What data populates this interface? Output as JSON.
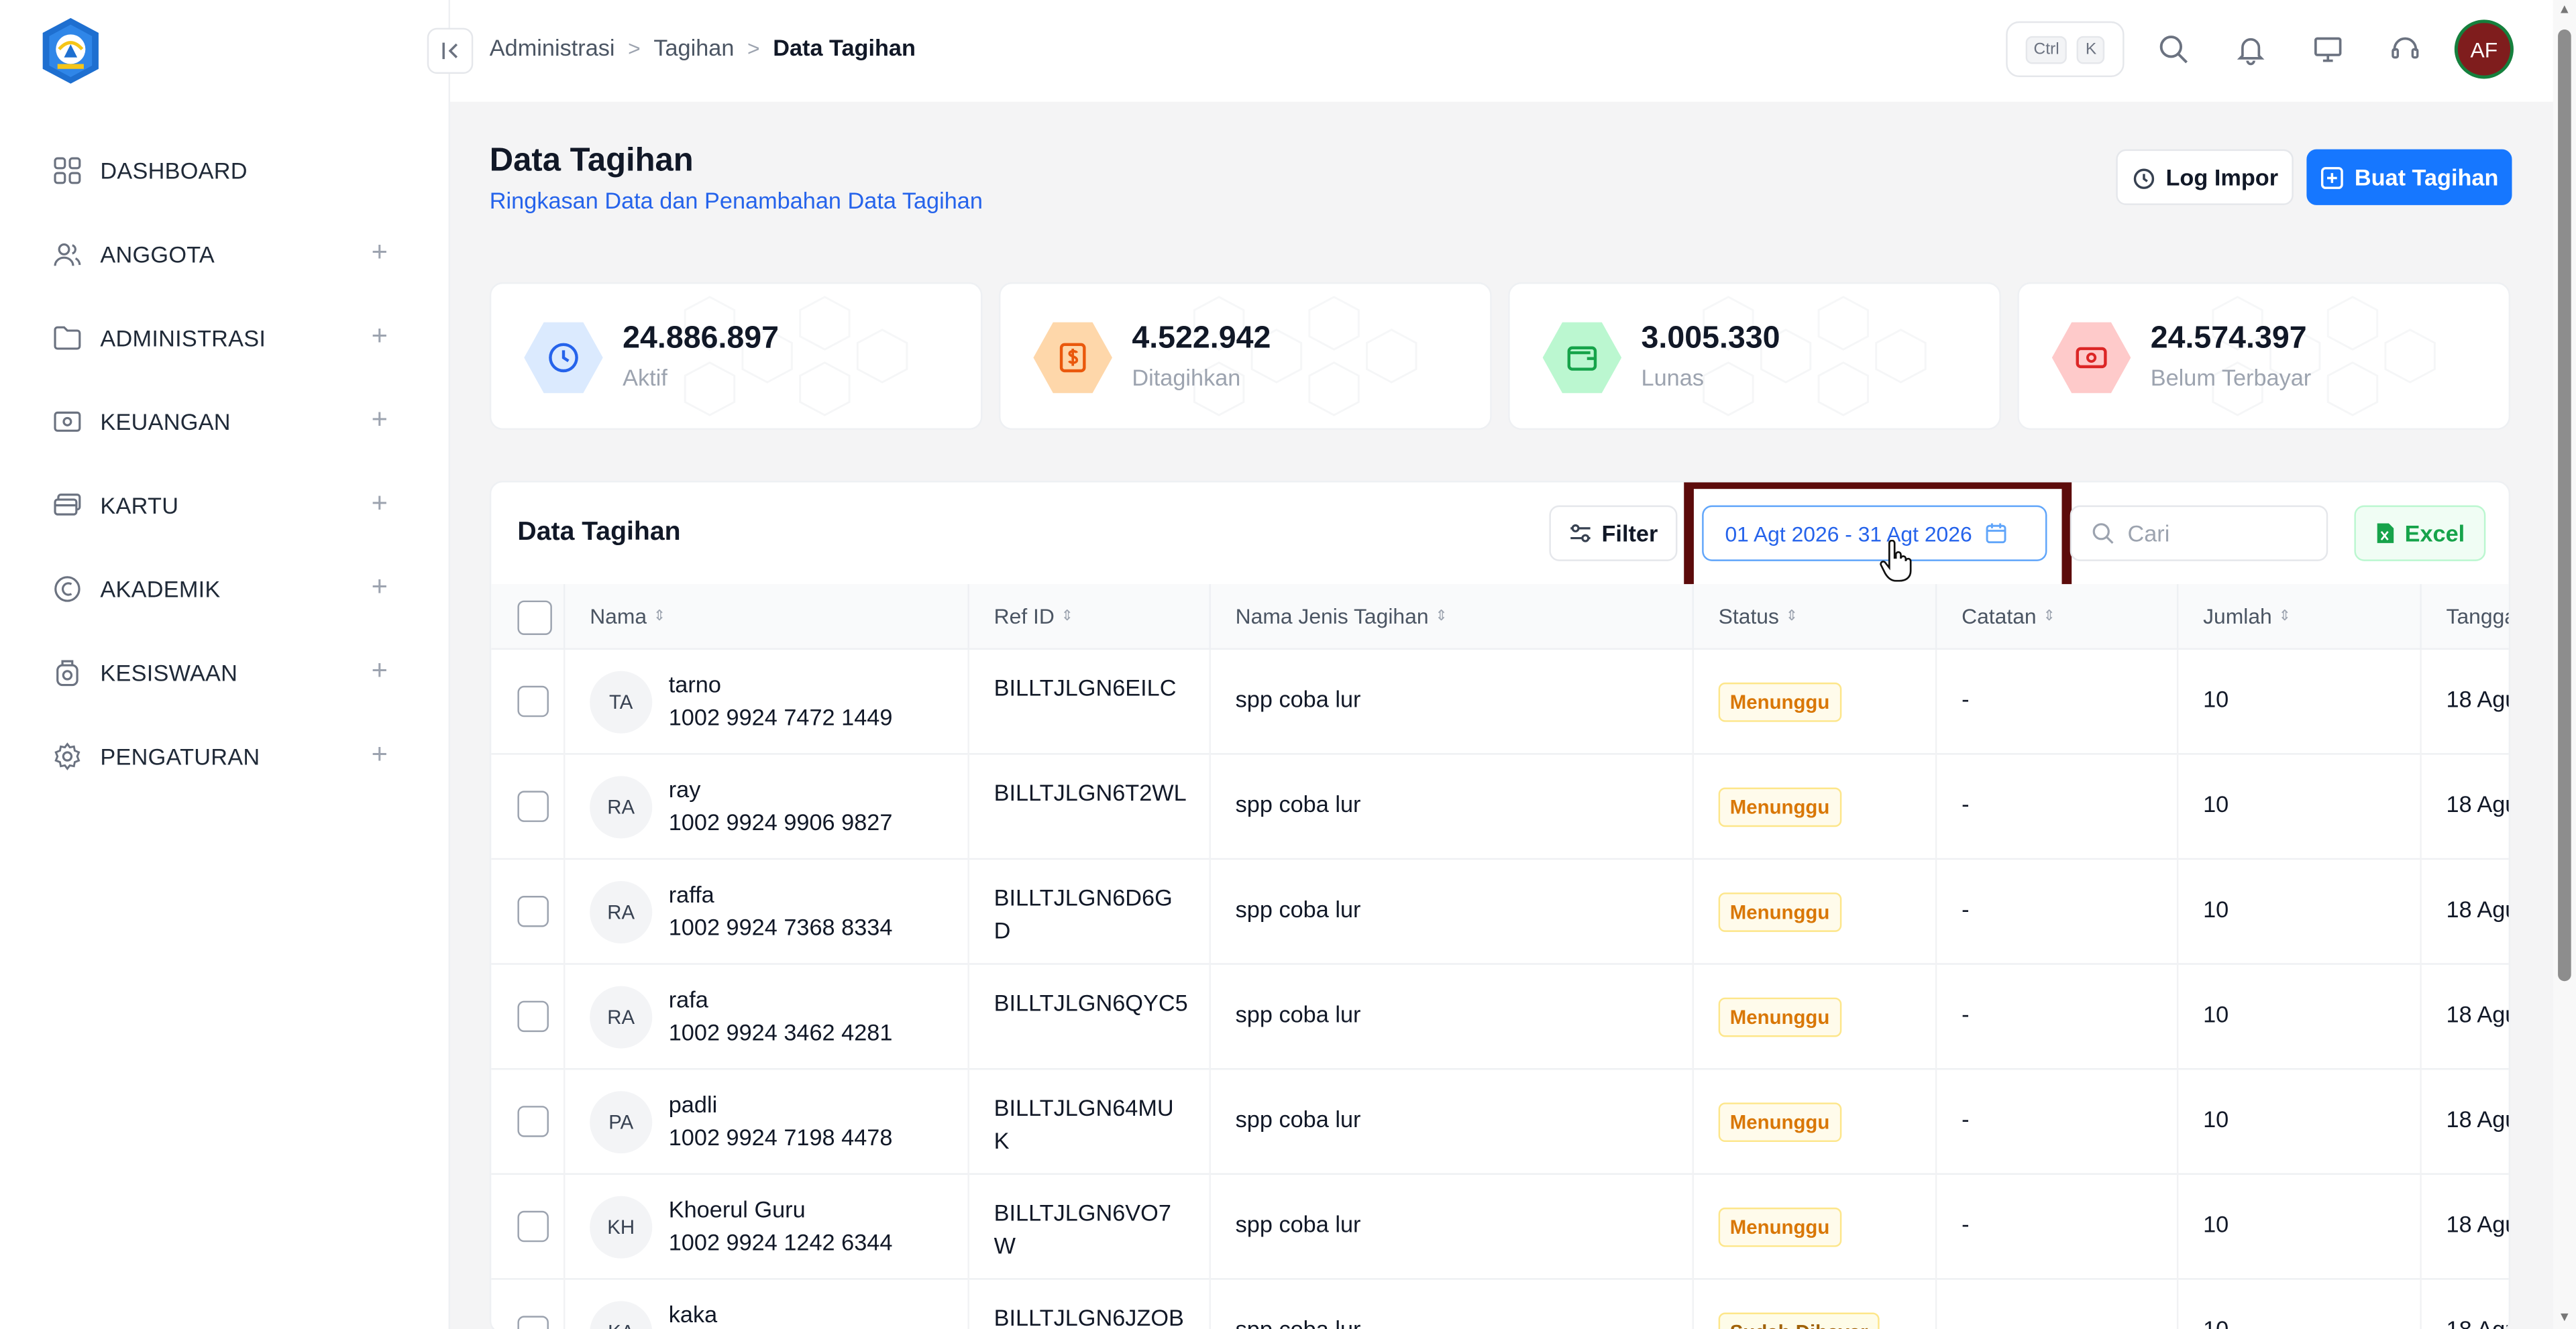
{
  "colors": {
    "primary": "#1677ff",
    "subtitle_link": "#2563eb",
    "status_waiting": "#d97706",
    "highlight_border": "#5c0b0b",
    "avatar_bg": "#7f1d1d"
  },
  "sidebar": {
    "logo": "tut-wuri-handayani-logo",
    "items": [
      {
        "label": "DASHBOARD",
        "icon": "grid-icon",
        "expandable": false
      },
      {
        "label": "ANGGOTA",
        "icon": "users-icon",
        "expandable": true
      },
      {
        "label": "ADMINISTRASI",
        "icon": "folder-icon",
        "expandable": true
      },
      {
        "label": "KEUANGAN",
        "icon": "money-icon",
        "expandable": true
      },
      {
        "label": "KARTU",
        "icon": "card-icon",
        "expandable": true
      },
      {
        "label": "AKADEMIK",
        "icon": "academic-icon",
        "expandable": true
      },
      {
        "label": "KESISWAAN",
        "icon": "student-icon",
        "expandable": true
      },
      {
        "label": "PENGATURAN",
        "icon": "gear-icon",
        "expandable": true
      }
    ],
    "plus_symbol": "+"
  },
  "topbar": {
    "breadcrumb": [
      "Administrasi",
      "Tagihan",
      "Data Tagihan"
    ],
    "breadcrumb_sep": ">",
    "shortcut": {
      "key1": "Ctrl",
      "key2": "K"
    },
    "avatar_initials": "AF"
  },
  "header": {
    "title": "Data Tagihan",
    "subtitle": "Ringkasan Data dan Penambahan Data Tagihan",
    "log_button": "Log Impor",
    "create_button": "Buat Tagihan"
  },
  "stats": [
    {
      "value": "24.886.897",
      "label": "Aktif",
      "icon": "clock-icon",
      "color": "#2563eb",
      "bg": "#dbeafe"
    },
    {
      "value": "4.522.942",
      "label": "Ditagihkan",
      "icon": "dollar-icon",
      "color": "#ea580c",
      "bg": "#fed7aa"
    },
    {
      "value": "3.005.330",
      "label": "Lunas",
      "icon": "wallet-icon",
      "color": "#16a34a",
      "bg": "#bbf7d0"
    },
    {
      "value": "24.574.397",
      "label": "Belum Terbayar",
      "icon": "cash-icon",
      "color": "#dc2626",
      "bg": "#fecaca"
    }
  ],
  "table": {
    "title": "Data Tagihan",
    "filter_label": "Filter",
    "date_range": "01 Agt 2026 - 31 Agt 2026",
    "search_placeholder": "Cari",
    "excel_label": "Excel",
    "columns": [
      "Nama",
      "Ref ID",
      "Nama Jenis Tagihan",
      "Status",
      "Catatan",
      "Jumlah",
      "Tangga"
    ],
    "rows": [
      {
        "initials": "TA",
        "name": "tarno",
        "nis": "1002 9924 7472 1449",
        "ref": "BILLTJLGN6EILC",
        "jenis": "spp coba lur",
        "status": "Menunggu",
        "catatan": "-",
        "jumlah": "10",
        "tanggal": "18 Agu"
      },
      {
        "initials": "RA",
        "name": "ray",
        "nis": "1002 9924 9906 9827",
        "ref": "BILLTJLGN6T2WL",
        "jenis": "spp coba lur",
        "status": "Menunggu",
        "catatan": "-",
        "jumlah": "10",
        "tanggal": "18 Agu"
      },
      {
        "initials": "RA",
        "name": "raffa",
        "nis": "1002 9924 7368 8334",
        "ref": "BILLTJLGN6D6GD",
        "jenis": "spp coba lur",
        "status": "Menunggu",
        "catatan": "-",
        "jumlah": "10",
        "tanggal": "18 Agu"
      },
      {
        "initials": "RA",
        "name": "rafa",
        "nis": "1002 9924 3462 4281",
        "ref": "BILLTJLGN6QYC5",
        "jenis": "spp coba lur",
        "status": "Menunggu",
        "catatan": "-",
        "jumlah": "10",
        "tanggal": "18 Agu"
      },
      {
        "initials": "PA",
        "name": "padli",
        "nis": "1002 9924 7198 4478",
        "ref": "BILLTJLGN64MUK",
        "jenis": "spp coba lur",
        "status": "Menunggu",
        "catatan": "-",
        "jumlah": "10",
        "tanggal": "18 Agu"
      },
      {
        "initials": "KH",
        "name": "Khoerul Guru",
        "nis": "1002 9924 1242 6344",
        "ref": "BILLTJLGN6VO7W",
        "jenis": "spp coba lur",
        "status": "Menunggu",
        "catatan": "-",
        "jumlah": "10",
        "tanggal": "18 Agu"
      },
      {
        "initials": "KA",
        "name": "kaka",
        "nis": "",
        "ref": "BILLTJLGN6JZOB",
        "jenis": "spp coba lur",
        "status": "Sudah Dibayar",
        "catatan": "-",
        "jumlah": "10",
        "tanggal": "18 Agu"
      }
    ]
  }
}
